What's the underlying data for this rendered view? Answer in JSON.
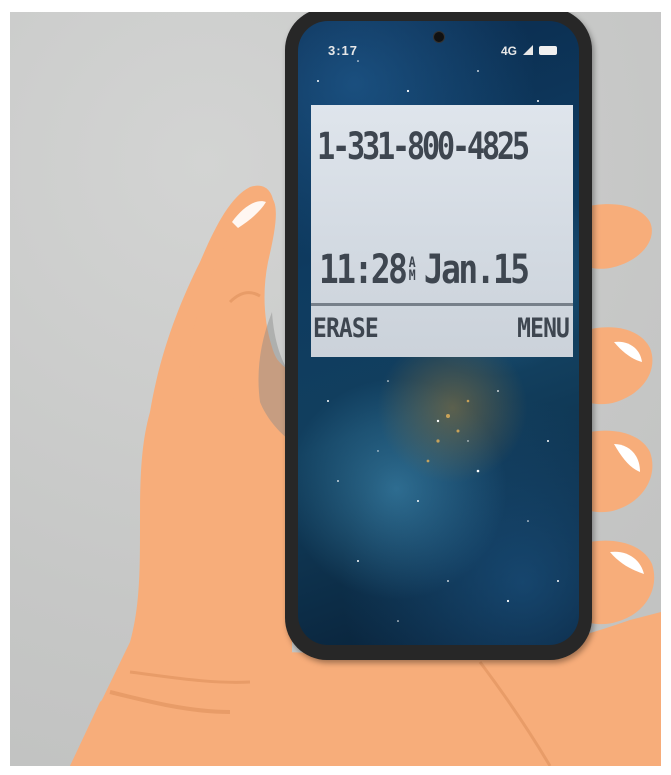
{
  "status_bar": {
    "time": "3:17",
    "network": "4G",
    "icons": [
      "signal-icon",
      "battery-icon"
    ]
  },
  "lcd": {
    "phone_number": "1-331-800-4825",
    "time": "11:28",
    "am_pm_top": "A",
    "am_pm_bottom": "M",
    "date": "Jan.15",
    "left_softkey": "ERASE",
    "right_softkey": "MENU"
  },
  "colors": {
    "skin": "#f7ad7a",
    "skin_shadow": "#e89c68",
    "phone_body": "#272727",
    "lcd_background": "#d4dbe2",
    "lcd_text": "#3e4650",
    "wall": "#c9cac9"
  }
}
